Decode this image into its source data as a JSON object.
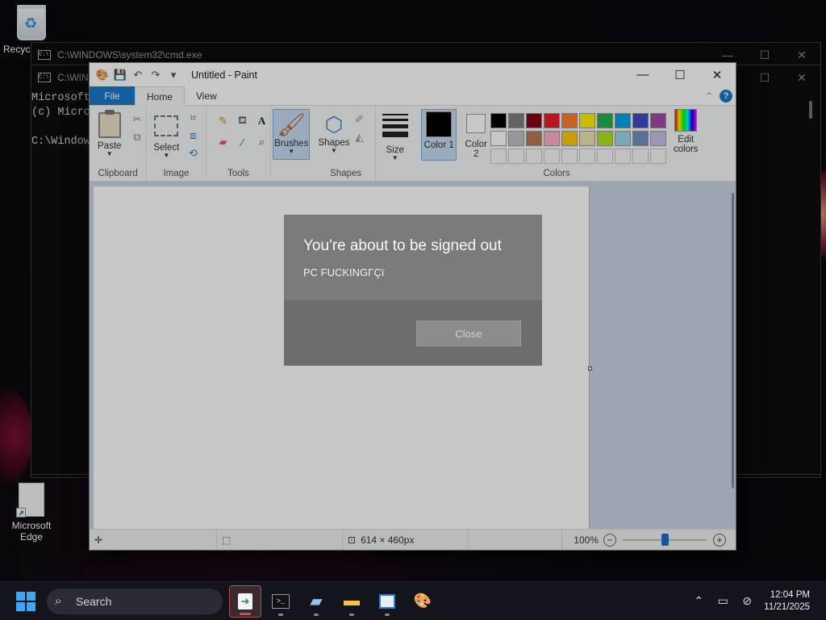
{
  "desktop": {
    "icons": [
      {
        "label": "Recyc"
      },
      {
        "label": "Microsoft Edge"
      }
    ]
  },
  "cmd_back": {
    "title": "C:\\WINDOWS\\system32\\cmd.exe",
    "controls": {
      "minimize": "—",
      "maximize": "☐",
      "close": "✕"
    }
  },
  "cmd_front": {
    "title": "C:\\WIN",
    "lines": [
      "Microsoft",
      "(c) Micro",
      "",
      "C:\\Window"
    ],
    "controls": {
      "minimize": "—",
      "maximize": "☐",
      "close": "✕"
    }
  },
  "paint": {
    "title": "Untitled - Paint",
    "controls": {
      "minimize": "—",
      "maximize": "☐",
      "close": "✕"
    },
    "tabs": {
      "file": "File",
      "home": "Home",
      "view": "View"
    },
    "ribbon": {
      "clipboard": {
        "label": "Clipboard",
        "paste": "Paste"
      },
      "image": {
        "label": "Image",
        "select": "Select"
      },
      "tools": {
        "label": "Tools"
      },
      "brushes": {
        "label": "Brushes"
      },
      "shapes": {
        "label": "Shapes",
        "button": "Shapes"
      },
      "size": {
        "label": "Size"
      },
      "colors": {
        "label": "Colors",
        "color1": "Color 1",
        "color2": "Color 2",
        "edit": "Edit colors",
        "color1_value": "#000000",
        "color2_value": "#ffffff",
        "palette": [
          "#000000",
          "#7f7f7f",
          "#880015",
          "#ed1c24",
          "#ff7f27",
          "#fff200",
          "#22b14c",
          "#00a2e8",
          "#3f48cc",
          "#a349a4",
          "#ffffff",
          "#c3c3c3",
          "#b97a57",
          "#ffaec9",
          "#ffc90e",
          "#efe4b0",
          "#b5e61d",
          "#99d9ea",
          "#7092be",
          "#c8bfe7"
        ]
      }
    },
    "status": {
      "dimensions": "614 × 460px",
      "zoom": "100%",
      "zoom_level": 1.0
    }
  },
  "dialog": {
    "title": "You're about to be signed out",
    "message": "PC FUCKINGΓÇï",
    "close": "Close"
  },
  "taskbar": {
    "search_placeholder": "Search",
    "time": "12:04 PM",
    "date": "11/21/2025",
    "apps": [
      "file-transfer-app",
      "terminal",
      "notepad-app",
      "file-explorer",
      "app-window",
      "paint"
    ]
  }
}
